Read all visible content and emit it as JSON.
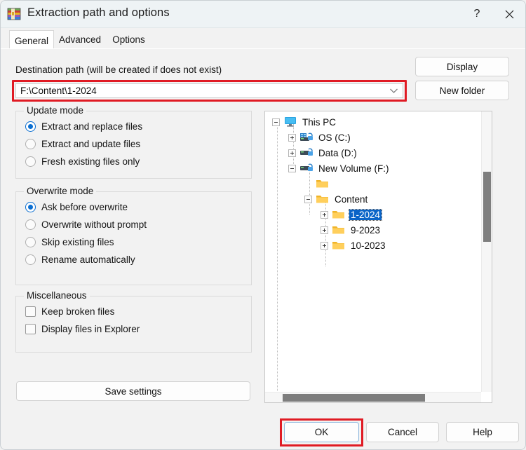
{
  "window": {
    "title": "Extraction path and options",
    "app_icon": "winrar-icon",
    "help_button": "?",
    "close_button": "close-icon"
  },
  "tabs": [
    {
      "label": "General",
      "active": true
    },
    {
      "label": "Advanced",
      "active": false
    },
    {
      "label": "Options",
      "active": false
    }
  ],
  "destination": {
    "label": "Destination path (will be created if does not exist)",
    "value": "F:\\Content\\1-2024",
    "dropdown_icon": "chevron-down-icon",
    "highlight_color": "#e01b24"
  },
  "side_buttons": {
    "display": "Display",
    "new_folder": "New folder"
  },
  "update_mode": {
    "title": "Update mode",
    "options": [
      {
        "label": "Extract and replace files",
        "selected": true
      },
      {
        "label": "Extract and update files",
        "selected": false
      },
      {
        "label": "Fresh existing files only",
        "selected": false
      }
    ]
  },
  "overwrite_mode": {
    "title": "Overwrite mode",
    "options": [
      {
        "label": "Ask before overwrite",
        "selected": true
      },
      {
        "label": "Overwrite without prompt",
        "selected": false
      },
      {
        "label": "Skip existing files",
        "selected": false
      },
      {
        "label": "Rename automatically",
        "selected": false
      }
    ]
  },
  "miscellaneous": {
    "title": "Miscellaneous",
    "options": [
      {
        "label": "Keep broken files",
        "checked": false
      },
      {
        "label": "Display files in Explorer",
        "checked": false
      }
    ]
  },
  "save_settings": {
    "label": "Save settings"
  },
  "tree": {
    "nodes": [
      {
        "label": "This PC",
        "icon": "this-pc-icon",
        "expander": "minus",
        "depth": 0,
        "selected": false
      },
      {
        "label": "OS (C:)",
        "icon": "drive-icon",
        "expander": "plus",
        "depth": 1,
        "selected": false
      },
      {
        "label": "Data (D:)",
        "icon": "drive-icon",
        "expander": "plus",
        "depth": 1,
        "selected": false
      },
      {
        "label": "New Volume (F:)",
        "icon": "drive-icon",
        "expander": "minus",
        "depth": 1,
        "selected": false
      },
      {
        "label": "",
        "icon": "folder-icon",
        "expander": "none",
        "depth": 2,
        "selected": false
      },
      {
        "label": "Content",
        "icon": "folder-icon",
        "expander": "minus",
        "depth": 2,
        "selected": false
      },
      {
        "label": "1-2024",
        "icon": "folder-icon",
        "expander": "plus",
        "depth": 3,
        "selected": true
      },
      {
        "label": "9-2023",
        "icon": "folder-icon",
        "expander": "plus",
        "depth": 3,
        "selected": false
      },
      {
        "label": "10-2023",
        "icon": "folder-icon",
        "expander": "plus",
        "depth": 3,
        "selected": false
      }
    ],
    "selection_color": "#0a64c8"
  },
  "footer": {
    "ok": "OK",
    "cancel": "Cancel",
    "help": "Help",
    "ok_highlight_color": "#e01b24"
  }
}
